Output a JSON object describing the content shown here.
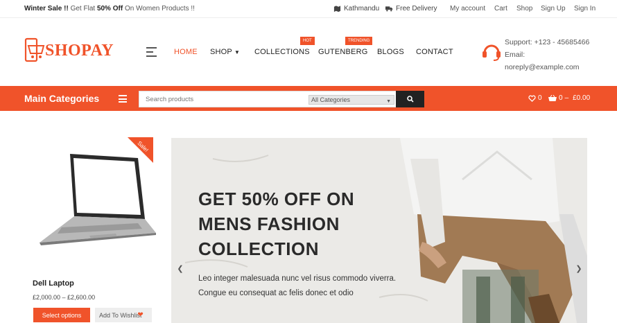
{
  "topbar": {
    "sale_prefix": "Winter Sale !!",
    "sale_mid": " Get Flat ",
    "sale_strong": "50% Off",
    "sale_suffix": " On Women Products !!",
    "location": "Kathmandu",
    "delivery": "Free Delivery",
    "links": [
      "My account",
      "Cart",
      "Shop",
      "Sign Up",
      "Sign In"
    ]
  },
  "brand": {
    "name": "SHOPAY",
    "accent": "#f0532a"
  },
  "nav": {
    "home": "HOME",
    "shop": "SHOP",
    "collections": "COLLECTIONS",
    "collections_badge": "HOT",
    "gutenberg": "GUTENBERG",
    "gutenberg_badge": "TRENDING",
    "blogs": "BLOGS",
    "contact": "CONTACT"
  },
  "support": {
    "line1": "Support: +123 - 45685466",
    "line2": "Email:",
    "line3": "noreply@example.com"
  },
  "catbar": {
    "title": "Main Categories",
    "search_placeholder": "Search products",
    "category_select": "All Categories",
    "wishlist_count": "0",
    "cart_count": "0",
    "cart_total": "£0.00"
  },
  "product": {
    "badge": "Sale!",
    "name": "Dell Laptop",
    "price": "£2,000.00 – £2,600.00",
    "select_label": "Select options",
    "wishlist_label": "Add To Wishlist"
  },
  "slider": {
    "headline": [
      "GET 50% OFF ON",
      "MENS FASHION",
      "COLLECTION"
    ],
    "body": "Leo integer malesuada nunc vel risus commodo viverra. Congue eu consequat ac felis donec et odio"
  }
}
